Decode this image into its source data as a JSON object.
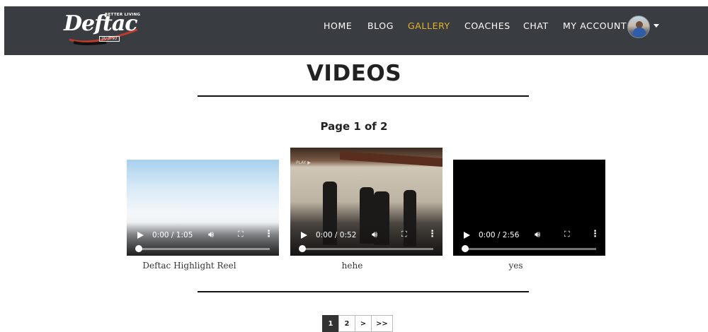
{
  "navbar": {
    "logo": {
      "brand": "Deftac",
      "tagline": "BETTER LIVING",
      "sub": "JIU JITSU"
    },
    "items": [
      {
        "label": "HOME",
        "active": false
      },
      {
        "label": "BLOG",
        "active": false
      },
      {
        "label": "GALLERY",
        "active": true
      },
      {
        "label": "COACHES",
        "active": false
      },
      {
        "label": "CHAT",
        "active": false
      },
      {
        "label": "MY ACCOUNT",
        "active": false
      }
    ],
    "active_color": "#e6b325",
    "background": "#393d42"
  },
  "main": {
    "title": "VIDEOS",
    "page_info": "Page 1 of 2",
    "videos": [
      {
        "caption": "Deftac Highlight Reel",
        "time": "0:00 / 1:05"
      },
      {
        "caption": "hehe",
        "time": "0:00 / 0:52",
        "overlay_label": "PLAY ▶"
      },
      {
        "caption": "yes",
        "time": "0:00 / 2:56"
      }
    ]
  },
  "pagination": {
    "pages": [
      "1",
      "2",
      ">",
      ">>"
    ],
    "current": "1"
  }
}
